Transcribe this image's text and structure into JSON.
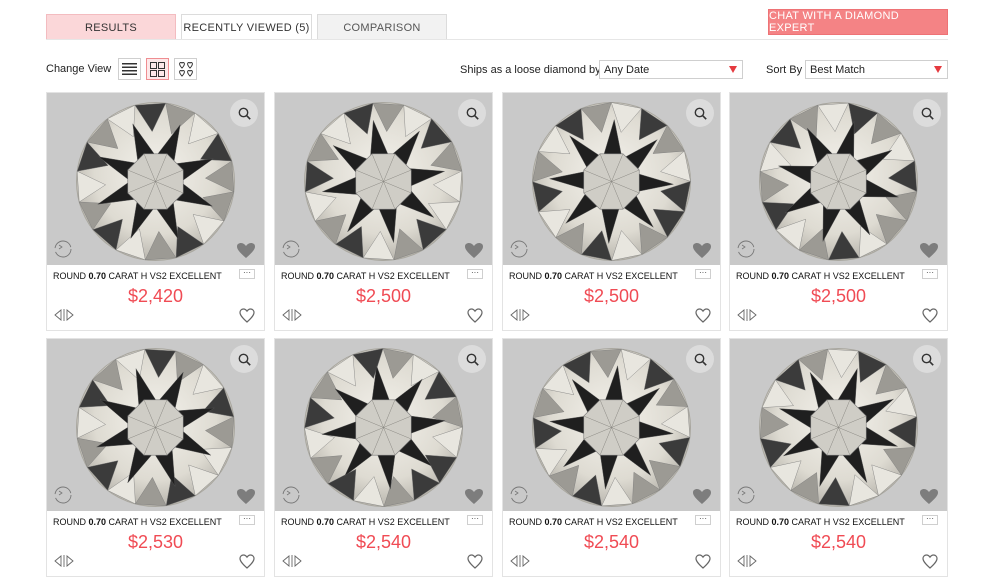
{
  "tabs": [
    {
      "label": "RESULTS"
    },
    {
      "label": "RECENTLY VIEWED (5)"
    },
    {
      "label": "COMPARISON"
    }
  ],
  "chat_button": "CHAT WITH A DIAMOND EXPERT",
  "change_view_label": "Change View",
  "ships_label": "Ships as a loose diamond by:",
  "ships_value": "Any Date",
  "sort_label": "Sort By",
  "sort_value": "Best Match",
  "colors": {
    "accent": "#f04b54",
    "tab_active": "#fbd7d9",
    "chat_button": "#f48385"
  },
  "more_label": "···",
  "products": [
    {
      "prefix": "ROUND ",
      "carat": "0.70",
      "rest": " CARAT H VS2 EXCELLENT",
      "price": "$2,420"
    },
    {
      "prefix": "ROUND ",
      "carat": "0.70",
      "rest": " CARAT H VS2 EXCELLENT",
      "price": "$2,500"
    },
    {
      "prefix": "ROUND ",
      "carat": "0.70",
      "rest": " CARAT H VS2 EXCELLENT",
      "price": "$2,500"
    },
    {
      "prefix": "ROUND ",
      "carat": "0.70",
      "rest": " CARAT H VS2 EXCELLENT",
      "price": "$2,500"
    },
    {
      "prefix": "ROUND ",
      "carat": "0.70",
      "rest": " CARAT H VS2 EXCELLENT",
      "price": "$2,530"
    },
    {
      "prefix": "ROUND ",
      "carat": "0.70",
      "rest": " CARAT H VS2 EXCELLENT",
      "price": "$2,540"
    },
    {
      "prefix": "ROUND ",
      "carat": "0.70",
      "rest": " CARAT H VS2 EXCELLENT",
      "price": "$2,540"
    },
    {
      "prefix": "ROUND ",
      "carat": "0.70",
      "rest": " CARAT H VS2 EXCELLENT",
      "price": "$2,540"
    }
  ]
}
